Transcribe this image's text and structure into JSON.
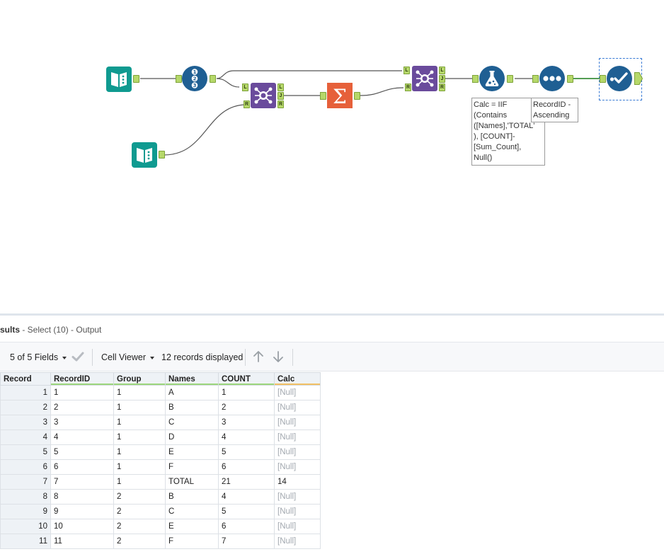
{
  "canvas": {
    "annotations": {
      "formula": [
        "Calc = IIF",
        "(Contains",
        "([Names],'TOTAL'",
        "), [COUNT]-",
        "[Sum_Count],",
        "Null()"
      ],
      "sort": [
        "RecordID -",
        "Ascending"
      ]
    },
    "join_anchor_labels": {
      "left": "L",
      "join": "J",
      "right": "R"
    },
    "icons": [
      "input-data-icon",
      "record-id-icon",
      "join-icon",
      "summarize-icon",
      "formula-icon",
      "sort-icon",
      "select-icon"
    ],
    "colors": {
      "input": "#0f9a90",
      "blue_tool": "#1f5f93",
      "join": "#6a4b9c",
      "summarize": "#e6603a",
      "anchor": "#b6d86a"
    }
  },
  "results": {
    "title_prefix": "sults",
    "title_suffix": " - Select (10) - Output",
    "toolbar": {
      "fields": "5 of 5 Fields",
      "viewer": "Cell Viewer",
      "records": "12 records displayed"
    },
    "columns": [
      "Record",
      "RecordID",
      "Group",
      "Names",
      "COUNT",
      "Calc"
    ],
    "rows": [
      [
        "1",
        "1",
        "1",
        "A",
        "1",
        "[Null]"
      ],
      [
        "2",
        "2",
        "1",
        "B",
        "2",
        "[Null]"
      ],
      [
        "3",
        "3",
        "1",
        "C",
        "3",
        "[Null]"
      ],
      [
        "4",
        "4",
        "1",
        "D",
        "4",
        "[Null]"
      ],
      [
        "5",
        "5",
        "1",
        "E",
        "5",
        "[Null]"
      ],
      [
        "6",
        "6",
        "1",
        "F",
        "6",
        "[Null]"
      ],
      [
        "7",
        "7",
        "1",
        "TOTAL",
        "21",
        "14"
      ],
      [
        "8",
        "8",
        "2",
        "B",
        "4",
        "[Null]"
      ],
      [
        "9",
        "9",
        "2",
        "C",
        "5",
        "[Null]"
      ],
      [
        "10",
        "10",
        "2",
        "E",
        "6",
        "[Null]"
      ],
      [
        "11",
        "11",
        "2",
        "F",
        "7",
        "[Null]"
      ]
    ]
  }
}
